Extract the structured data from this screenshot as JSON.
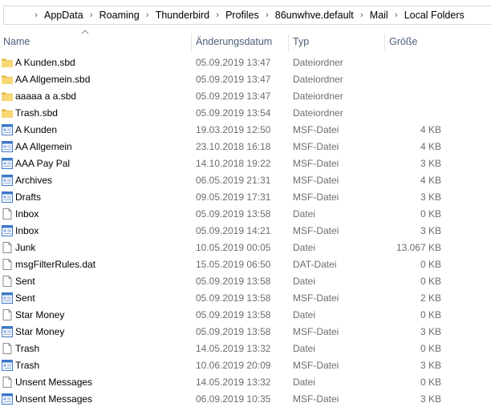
{
  "breadcrumb": [
    "AppData",
    "Roaming",
    "Thunderbird",
    "Profiles",
    "86unwhve.default",
    "Mail",
    "Local Folders"
  ],
  "columns": {
    "name": "Name",
    "date": "Änderungsdatum",
    "type": "Typ",
    "size": "Größe"
  },
  "files": [
    {
      "name": "A Kunden.sbd",
      "date": "05.09.2019 13:47",
      "type": "Dateiordner",
      "size": "",
      "icon": "folder-icon"
    },
    {
      "name": "AA Allgemein.sbd",
      "date": "05.09.2019 13:47",
      "type": "Dateiordner",
      "size": "",
      "icon": "folder-icon"
    },
    {
      "name": "aaaaa a a.sbd",
      "date": "05.09.2019 13:47",
      "type": "Dateiordner",
      "size": "",
      "icon": "folder-icon"
    },
    {
      "name": "Trash.sbd",
      "date": "05.09.2019 13:54",
      "type": "Dateiordner",
      "size": "",
      "icon": "folder-icon"
    },
    {
      "name": "A Kunden",
      "date": "19.03.2019 12:50",
      "type": "MSF-Datei",
      "size": "4 KB",
      "icon": "msf-file-icon"
    },
    {
      "name": "AA Allgemein",
      "date": "23.10.2018 16:18",
      "type": "MSF-Datei",
      "size": "4 KB",
      "icon": "msf-file-icon"
    },
    {
      "name": "AAA Pay Pal",
      "date": "14.10.2018 19:22",
      "type": "MSF-Datei",
      "size": "3 KB",
      "icon": "msf-file-icon"
    },
    {
      "name": "Archives",
      "date": "06.05.2019 21:31",
      "type": "MSF-Datei",
      "size": "4 KB",
      "icon": "msf-file-icon"
    },
    {
      "name": "Drafts",
      "date": "09.05.2019 17:31",
      "type": "MSF-Datei",
      "size": "3 KB",
      "icon": "msf-file-icon"
    },
    {
      "name": "Inbox",
      "date": "05.09.2019 13:58",
      "type": "Datei",
      "size": "0 KB",
      "icon": "blank-file-icon"
    },
    {
      "name": "Inbox",
      "date": "05.09.2019 14:21",
      "type": "MSF-Datei",
      "size": "3 KB",
      "icon": "msf-file-icon"
    },
    {
      "name": "Junk",
      "date": "10.05.2019 00:05",
      "type": "Datei",
      "size": "13.067 KB",
      "icon": "blank-file-icon"
    },
    {
      "name": "msgFilterRules.dat",
      "date": "15.05.2019 06:50",
      "type": "DAT-Datei",
      "size": "0 KB",
      "icon": "blank-file-icon"
    },
    {
      "name": "Sent",
      "date": "05.09.2019 13:58",
      "type": "Datei",
      "size": "0 KB",
      "icon": "blank-file-icon"
    },
    {
      "name": "Sent",
      "date": "05.09.2019 13:58",
      "type": "MSF-Datei",
      "size": "2 KB",
      "icon": "msf-file-icon"
    },
    {
      "name": "Star Money",
      "date": "05.09.2019 13:58",
      "type": "Datei",
      "size": "0 KB",
      "icon": "blank-file-icon"
    },
    {
      "name": "Star Money",
      "date": "05.09.2019 13:58",
      "type": "MSF-Datei",
      "size": "3 KB",
      "icon": "msf-file-icon"
    },
    {
      "name": "Trash",
      "date": "14.05.2019 13:32",
      "type": "Datei",
      "size": "0 KB",
      "icon": "blank-file-icon"
    },
    {
      "name": "Trash",
      "date": "10.06.2019 20:09",
      "type": "MSF-Datei",
      "size": "3 KB",
      "icon": "msf-file-icon"
    },
    {
      "name": "Unsent Messages",
      "date": "14.05.2019 13:32",
      "type": "Datei",
      "size": "0 KB",
      "icon": "blank-file-icon"
    },
    {
      "name": "Unsent Messages",
      "date": "06.09.2019 10:35",
      "type": "MSF-Datei",
      "size": "3 KB",
      "icon": "msf-file-icon"
    }
  ],
  "colors": {
    "folder": "#f8d775",
    "folder_dark": "#e0b034",
    "header_text": "#4c607a",
    "secondary_text": "#6d6d6d",
    "msf_blue": "#3c78c8"
  }
}
